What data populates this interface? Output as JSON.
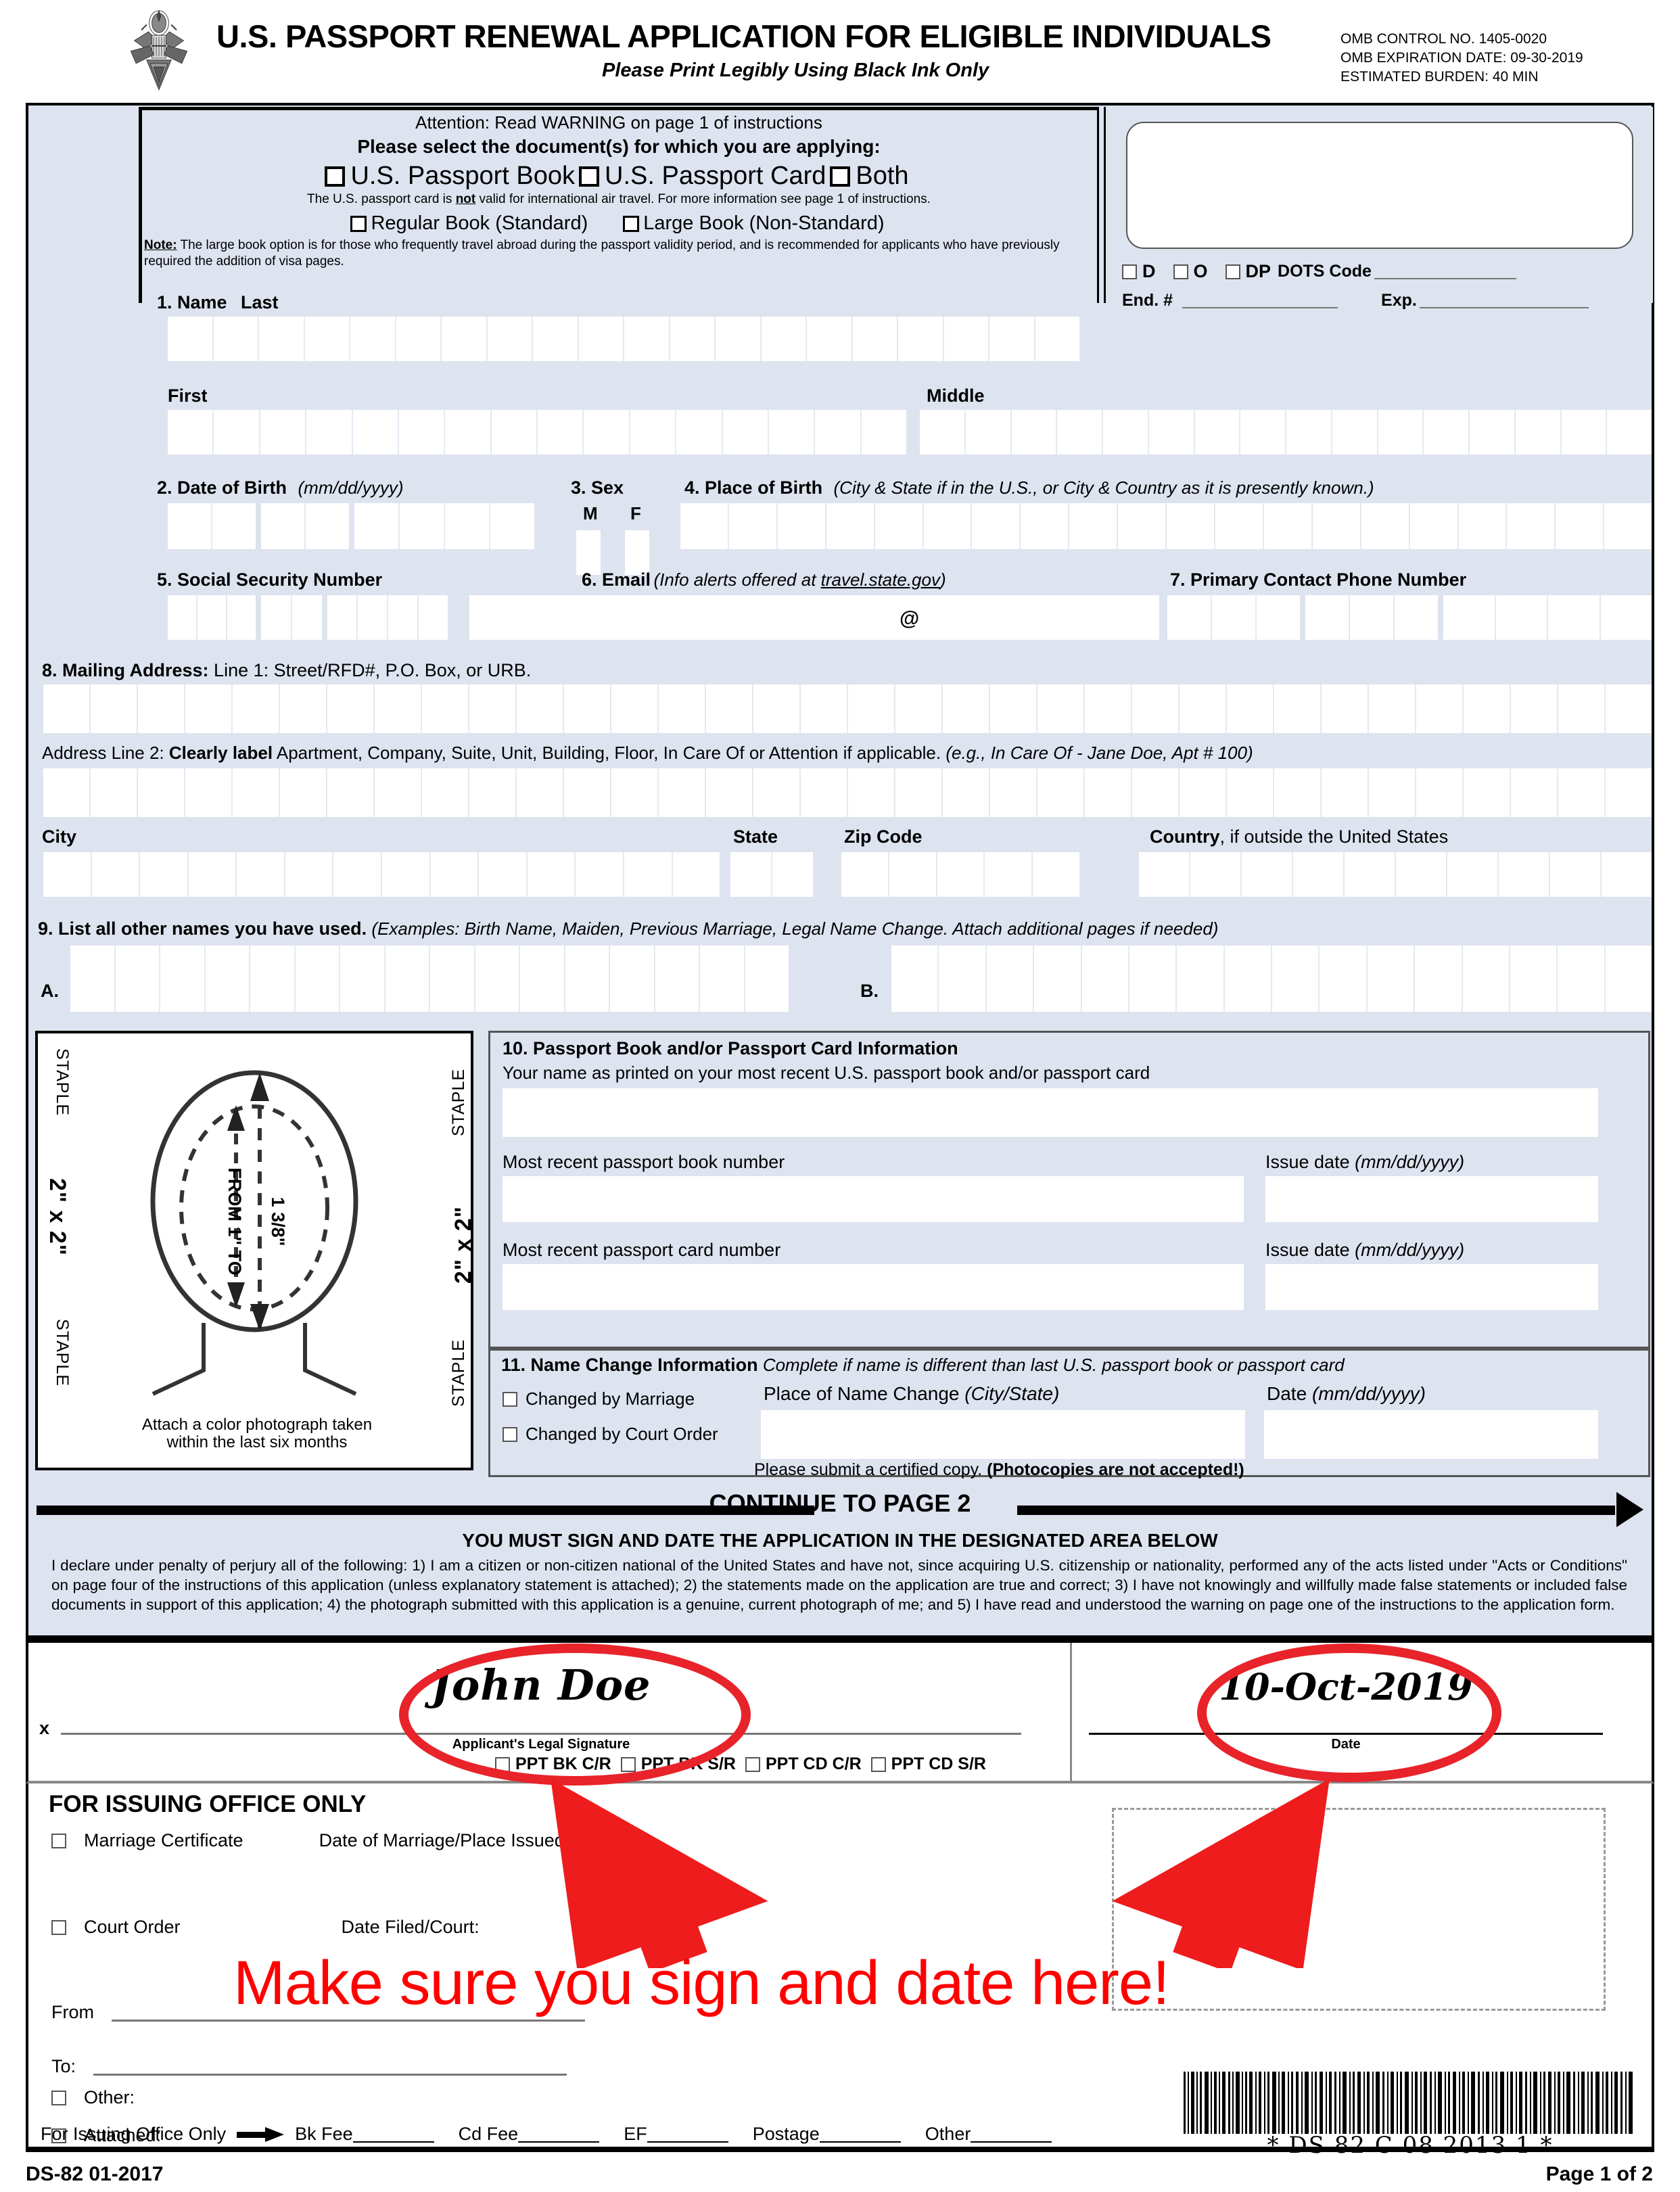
{
  "header": {
    "title": "U.S. PASSPORT RENEWAL APPLICATION FOR ELIGIBLE INDIVIDUALS",
    "subtitle": "Please Print Legibly Using Black Ink Only",
    "omb_control": "OMB CONTROL NO. 1405-0020",
    "omb_expiration": "OMB EXPIRATION DATE:  09-30-2019",
    "estimated_burden": "ESTIMATED BURDEN: 40 MIN"
  },
  "doc_select": {
    "attention": "Attention: Read WARNING on page 1 of instructions",
    "instruction": "Please select the document(s) for which you are applying:",
    "options": [
      {
        "label": "U.S. Passport Book"
      },
      {
        "label": "U.S. Passport Card"
      },
      {
        "label": "Both"
      }
    ],
    "card_note_a": "The U.S. passport card is ",
    "card_note_not": "not",
    "card_note_b": " valid for international air travel. For more information see page 1 of instructions.",
    "book_options": [
      {
        "label": "Regular Book (Standard)"
      },
      {
        "label": "Large Book (Non-Standard)"
      }
    ],
    "note_label": "Note:",
    "note_text": " The large book option is for those who frequently travel abroad during the passport validity period, and is recommended for applicants who have previously required the addition of visa pages."
  },
  "office_top": {
    "checkboxes": [
      {
        "label": "D"
      },
      {
        "label": "O"
      },
      {
        "label": "DP"
      }
    ],
    "dots_code_label": "DOTS Code",
    "end_label": "End. #",
    "exp_label": "Exp."
  },
  "fields": {
    "name_header": "1.  Name",
    "name_last": "Last",
    "name_first": "First",
    "name_middle": "Middle",
    "dob_num": "2.  Date of Birth",
    "dob_fmt": "(mm/dd/yyyy)",
    "sex_num": "3.  Sex",
    "sex_m": "M",
    "sex_f": "F",
    "pob_num": "4.  Place of Birth",
    "pob_hint": "(City & State if in the U.S., or City & Country as it is presently known.)",
    "ssn": "5.  Social Security Number",
    "email_num": "6. Email",
    "email_hint_a": "(Info alerts offered at ",
    "email_hint_link": "travel.state.gov",
    "email_hint_b": ")",
    "email_at": "@",
    "phone": "7. Primary Contact Phone Number",
    "mail_label_bold": "8. Mailing Address:",
    "mail_label_rest": " Line 1: Street/RFD#, P.O. Box, or URB.",
    "addr2_a": "Address Line 2: ",
    "addr2_bold": "Clearly label",
    "addr2_b": " Apartment, Company, Suite, Unit, Building, Floor, In Care Of or Attention if applicable. ",
    "addr2_i": "(e.g., In Care Of - Jane Doe, Apt # 100)",
    "city": "City",
    "state": "State",
    "zip": "Zip Code",
    "country_bold": "Country",
    "country_rest": ", if outside the United States",
    "other_names_bold": "9. List all other names you have used.",
    "other_names_i": " (Examples: Birth Name, Maiden, Previous Marriage, Legal Name Change.  Attach additional  pages if needed)",
    "other_a": "A.",
    "other_b": "B."
  },
  "photo_box": {
    "staple": "STAPLE",
    "size": "2\" x 2\"",
    "from_to": "FROM 1\" TO",
    "measure": "1 3/8\"",
    "caption_l1": "Attach a color photograph taken",
    "caption_l2": "within the last six months"
  },
  "section10": {
    "title": "10. Passport Book and/or Passport Card Information",
    "subtitle": "Your name as printed on your most recent U.S. passport book and/or passport card",
    "book_number": "Most recent passport book number",
    "book_issue": "Issue date",
    "book_issue_fmt": "(mm/dd/yyyy)",
    "card_number": "Most recent passport card number",
    "card_issue": "Issue date",
    "card_issue_fmt": "(mm/dd/yyyy)"
  },
  "section11": {
    "title_bold": "11. Name Change Information",
    "title_italic": " Complete if name is different than last U.S. passport book or passport card",
    "marriage": "Changed by Marriage",
    "court": "Changed by Court Order",
    "place_label": "Place of Name Change",
    "place_fmt": "(City/State)",
    "date_label": "Date",
    "date_fmt": "(mm/dd/yyyy)",
    "footer_normal": "Please submit a certified copy.  ",
    "footer_bold": "(Photocopies are not accepted!)"
  },
  "declaration": {
    "continue": "CONTINUE TO PAGE 2",
    "must_sign": "YOU MUST SIGN AND DATE THE APPLICATION IN THE DESIGNATED AREA BELOW",
    "body": "I declare under penalty of perjury all of the following: 1) I am a citizen or non-citizen national of the United States and have not, since acquiring U.S. citizenship or nationality, performed any of the acts listed under \"Acts or Conditions\" on page four of the instructions of this application (unless explanatory statement is attached); 2) the statements made on the application are true and correct; 3) I have not knowingly and willfully made false statements or included false documents in support of this application; 4) the photograph submitted with this application is a genuine, current photograph of me; and 5) I have read and understood the warning on page one of the instructions to the application form."
  },
  "signature": {
    "x_mark": "x",
    "value": "John Doe",
    "caption": "Applicant's Legal Signature",
    "date_value": "10-Oct-2019",
    "date_caption": "Date"
  },
  "issuing_office": {
    "title": "FOR ISSUING OFFICE ONLY",
    "ppt_checkboxes": [
      {
        "label": "PPT BK C/R"
      },
      {
        "label": "PPT BK S/R"
      },
      {
        "label": "PPT CD C/R"
      },
      {
        "label": "PPT CD S/R"
      }
    ],
    "marriage_cert": "Marriage Certificate",
    "marriage_date": "Date of Marriage/Place Issued:",
    "court_order": "Court Order",
    "court_date": "Date Filed/Court:",
    "from": "From",
    "to": "To:",
    "other": "Other:",
    "attached": "Attached:",
    "fee_prefix": "For Issuing Office Only",
    "fees": [
      {
        "label": "Bk Fee"
      },
      {
        "label": "Cd Fee"
      },
      {
        "label": "EF"
      },
      {
        "label": "Postage"
      },
      {
        "label": "Other"
      }
    ],
    "barcode_text": "* DS 82 C 08 2013 1 *"
  },
  "annotations": {
    "red_note": "Make sure you sign and date here!",
    "red_color": "#ff0000",
    "circle_color": "#e8232a"
  },
  "footer": {
    "form_id": "DS-82  01-2017",
    "page": "Page 1 of 2"
  }
}
